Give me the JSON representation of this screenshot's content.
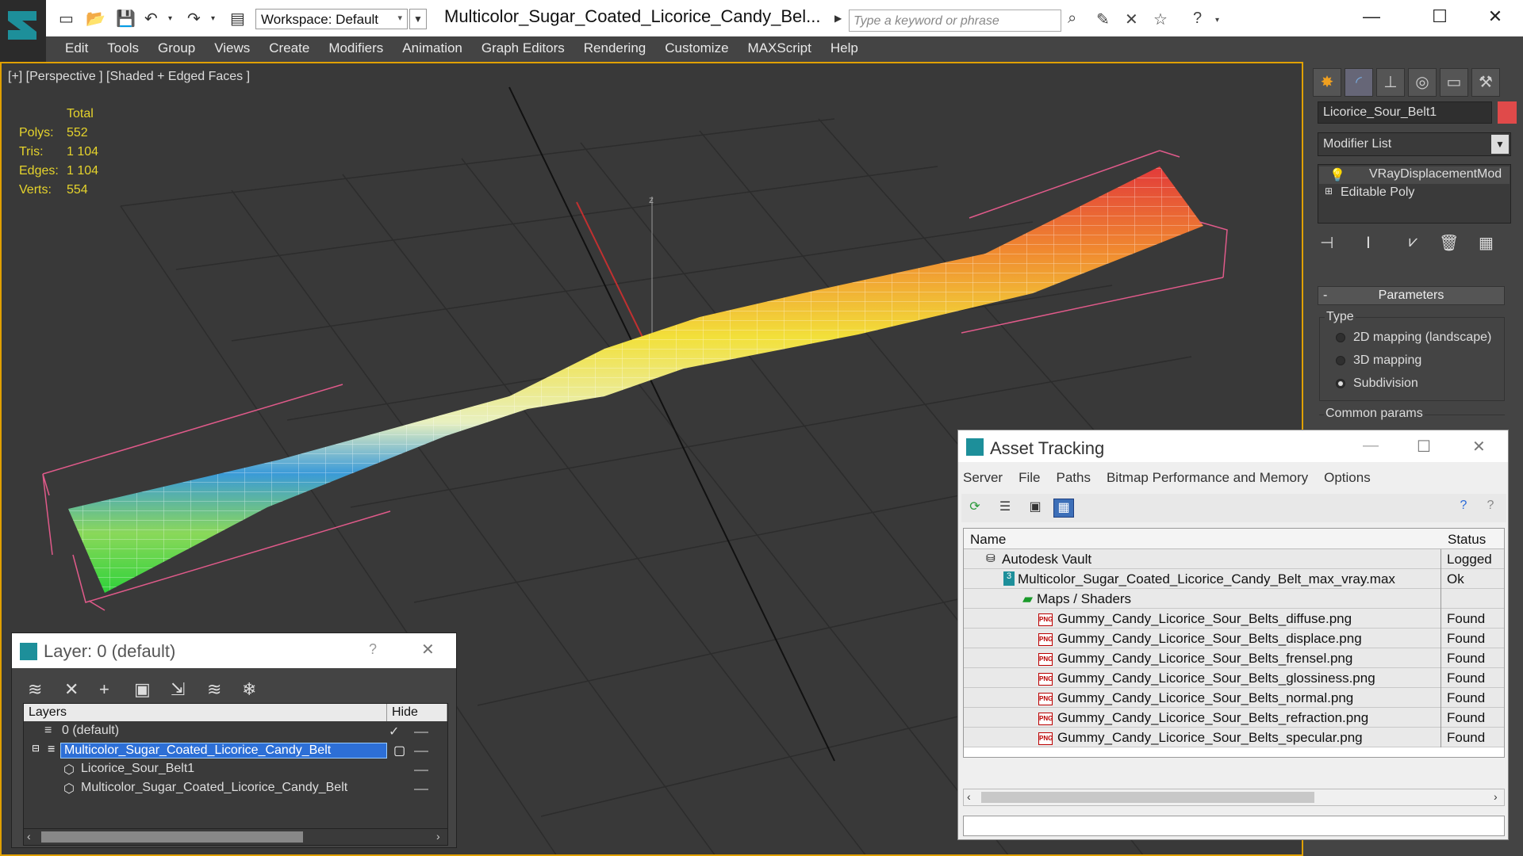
{
  "app": {
    "workspace_label": "Workspace: Default",
    "document_title": "Multicolor_Sugar_Coated_Licorice_Candy_Bel...",
    "search_placeholder": "Type a keyword or phrase"
  },
  "menu": [
    "Edit",
    "Tools",
    "Group",
    "Views",
    "Create",
    "Modifiers",
    "Animation",
    "Graph Editors",
    "Rendering",
    "Customize",
    "MAXScript",
    "Help"
  ],
  "viewport": {
    "label": "[+] [Perspective ] [Shaded + Edged Faces ]",
    "stats_header": "Total",
    "stats": [
      {
        "key": "Polys:",
        "value": "552"
      },
      {
        "key": "Tris:",
        "value": "1 104"
      },
      {
        "key": "Edges:",
        "value": "1 104"
      },
      {
        "key": "Verts:",
        "value": "554"
      }
    ],
    "axis_label": "z"
  },
  "command_panel": {
    "object_name": "Licorice_Sour_Belt1",
    "object_color": "#e04a4a",
    "modifier_list": "Modifier List",
    "stack": [
      "VRayDisplacementMod",
      "Editable Poly"
    ],
    "parameters_title": "Parameters",
    "collapse": "-",
    "type_group": "Type",
    "type_options": [
      {
        "label": "2D mapping (landscape)",
        "selected": false
      },
      {
        "label": "3D mapping",
        "selected": false
      },
      {
        "label": "Subdivision",
        "selected": true
      }
    ],
    "common_params": "Common params"
  },
  "asset_tracking": {
    "title": "Asset Tracking",
    "menu": [
      "Server",
      "File",
      "Paths",
      "Bitmap Performance and Memory",
      "Options"
    ],
    "col_name": "Name",
    "col_status": "Status",
    "rows": [
      {
        "name": "Autodesk Vault",
        "status": "Logged O"
      },
      {
        "name": "Multicolor_Sugar_Coated_Licorice_Candy_Belt_max_vray.max",
        "status": "Ok"
      },
      {
        "name": "Maps / Shaders",
        "status": ""
      },
      {
        "name": "Gummy_Candy_Licorice_Sour_Belts_diffuse.png",
        "status": "Found"
      },
      {
        "name": "Gummy_Candy_Licorice_Sour_Belts_displace.png",
        "status": "Found"
      },
      {
        "name": "Gummy_Candy_Licorice_Sour_Belts_frensel.png",
        "status": "Found"
      },
      {
        "name": "Gummy_Candy_Licorice_Sour_Belts_glossiness.png",
        "status": "Found"
      },
      {
        "name": "Gummy_Candy_Licorice_Sour_Belts_normal.png",
        "status": "Found"
      },
      {
        "name": "Gummy_Candy_Licorice_Sour_Belts_refraction.png",
        "status": "Found"
      },
      {
        "name": "Gummy_Candy_Licorice_Sour_Belts_specular.png",
        "status": "Found"
      }
    ],
    "png_badge": "PNG"
  },
  "layer_dialog": {
    "title": "Layer: 0 (default)",
    "help": "?",
    "col_layers": "Layers",
    "col_hide": "Hide",
    "rows": [
      {
        "name": "0 (default)"
      },
      {
        "name": "Multicolor_Sugar_Coated_Licorice_Candy_Belt"
      },
      {
        "name": "Licorice_Sour_Belt1"
      },
      {
        "name": "Multicolor_Sugar_Coated_Licorice_Candy_Belt"
      }
    ]
  }
}
